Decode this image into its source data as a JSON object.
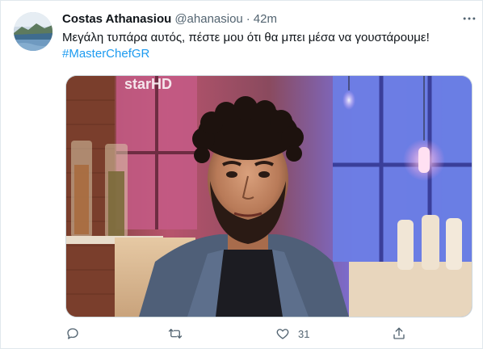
{
  "tweet": {
    "author_name": "Costas Athanasiou",
    "handle": "@ahanasiou",
    "separator": "·",
    "timestamp": "42m",
    "text": "Μεγάλη τυπάρα αυτός, πέστε μου ότι θα μπει μέσα να γουστάρουμε!",
    "hashtag": "#MasterChefGR",
    "media_watermark": "starHD",
    "like_count": "31"
  },
  "icons": {
    "more": "more-horizontal-icon",
    "reply": "reply-icon",
    "retweet": "retweet-icon",
    "like": "heart-icon",
    "share": "share-icon"
  },
  "colors": {
    "text_primary": "#0f1419",
    "text_secondary": "#536471",
    "link_blue": "#1d9bf0",
    "border": "#cfd9de"
  }
}
